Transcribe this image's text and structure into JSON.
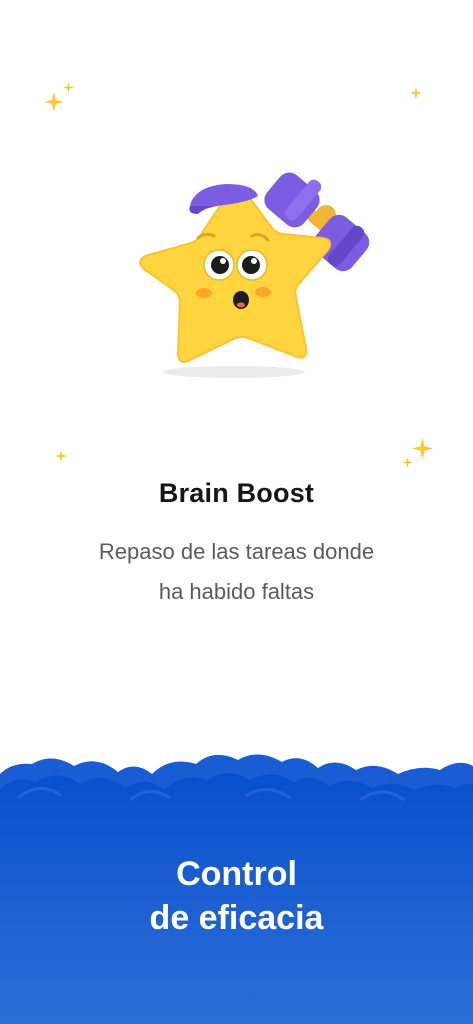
{
  "feature": {
    "title": "Brain Boost",
    "description_line1": "Repaso de las tareas donde",
    "description_line2": "ha habido faltas"
  },
  "banner": {
    "line1": "Control",
    "line2": "de eficacia"
  },
  "colors": {
    "star_yellow": "#FFD43F",
    "dumbbell_purple": "#7C5CE0",
    "banner_blue": "#0A52CC",
    "sparkle_yellow": "#F7C92E"
  },
  "icons": {
    "mascot": "star-mascot-with-dumbbell",
    "sparkles": "sparkle-icon"
  }
}
